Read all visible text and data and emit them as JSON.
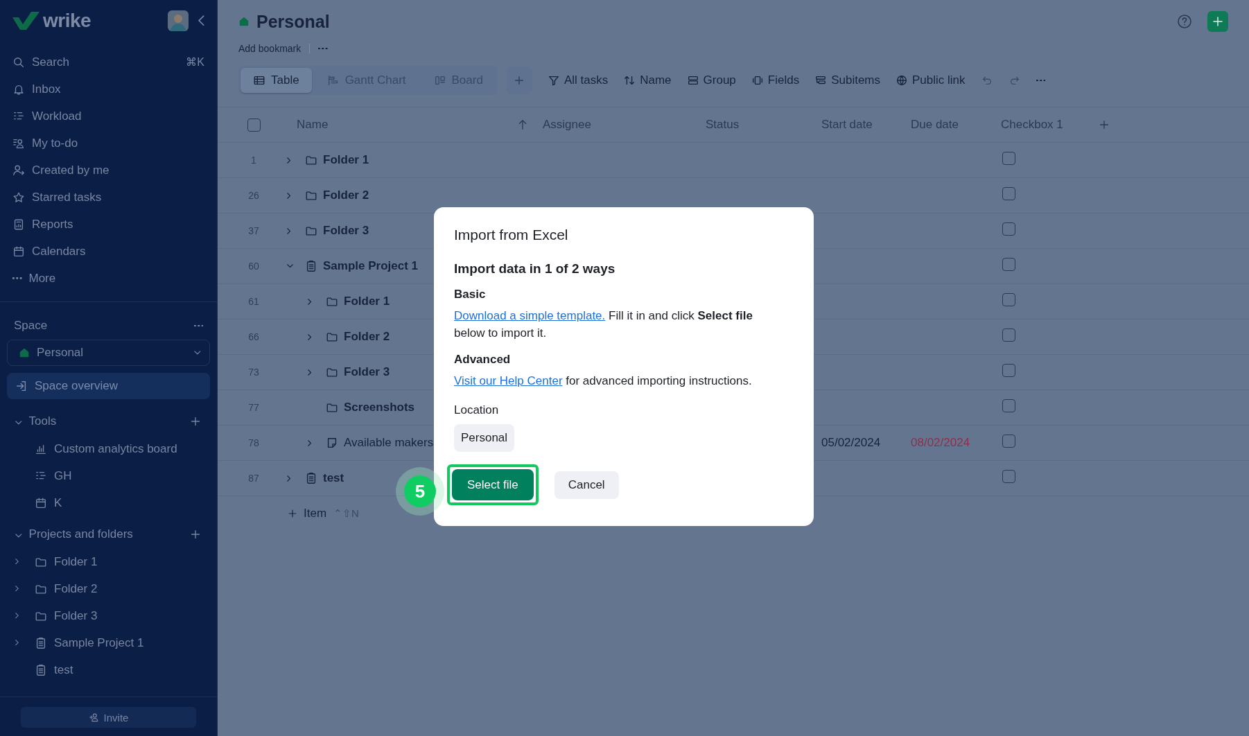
{
  "sidebar": {
    "logo": "wrike",
    "nav": [
      {
        "kind": "search",
        "label": "Search",
        "shortcut": "⌘K"
      },
      {
        "kind": "bell",
        "label": "Inbox"
      },
      {
        "kind": "workload",
        "label": "Workload"
      },
      {
        "kind": "todo",
        "label": "My to-do"
      },
      {
        "kind": "user",
        "label": "Created by me"
      },
      {
        "kind": "star",
        "label": "Starred tasks"
      },
      {
        "kind": "report",
        "label": "Reports"
      },
      {
        "kind": "calendar",
        "label": "Calendars"
      },
      {
        "kind": "dots",
        "label": "More"
      }
    ],
    "space_label": "Space",
    "space_selector": "Personal",
    "space_overview": {
      "label": "Space overview",
      "selected": true
    },
    "tools": {
      "label": "Tools",
      "expanded": true,
      "items": [
        {
          "kind": "analytics",
          "label": "Custom analytics board"
        },
        {
          "kind": "workload",
          "label": "GH"
        },
        {
          "kind": "calendar",
          "label": "K"
        }
      ]
    },
    "projects": {
      "label": "Projects and folders",
      "expanded": true,
      "items": [
        {
          "kind": "folder",
          "label": "Folder 1",
          "expandable": true
        },
        {
          "kind": "folder",
          "label": "Folder 2",
          "expandable": true
        },
        {
          "kind": "folder",
          "label": "Folder 3",
          "expandable": true
        },
        {
          "kind": "project",
          "label": "Sample Project 1",
          "expandable": true
        },
        {
          "kind": "project",
          "label": "test",
          "expandable": false
        }
      ]
    },
    "invite": "Invite"
  },
  "header": {
    "title": "Personal",
    "add_bookmark": "Add bookmark"
  },
  "views": [
    {
      "kind": "table",
      "label": "Table",
      "selected": true
    },
    {
      "kind": "gantt",
      "label": "Gantt Chart",
      "selected": false
    },
    {
      "kind": "board",
      "label": "Board",
      "selected": false
    }
  ],
  "toolbar": [
    {
      "kind": "filter",
      "label": "All tasks"
    },
    {
      "kind": "sort",
      "label": "Name"
    },
    {
      "kind": "group",
      "label": "Group"
    },
    {
      "kind": "fields",
      "label": "Fields"
    },
    {
      "kind": "subitems",
      "label": "Subitems"
    },
    {
      "kind": "globe",
      "label": "Public link"
    }
  ],
  "table": {
    "select_all": {
      "checked": false
    },
    "columns": [
      "Name",
      "Assignee",
      "Status",
      "Start date",
      "Due date",
      "Checkbox 1"
    ],
    "rows": [
      {
        "number": "1",
        "kind": "folder",
        "name": "Folder 1",
        "expandable": true,
        "expanded": false,
        "checked": false
      },
      {
        "number": "26",
        "kind": "folder",
        "name": "Folder 2",
        "expandable": true,
        "expanded": false,
        "checked": false
      },
      {
        "number": "37",
        "kind": "folder",
        "name": "Folder 3",
        "expandable": true,
        "expanded": false,
        "checked": false
      },
      {
        "number": "60",
        "kind": "project",
        "name": "Sample Project 1",
        "expandable": true,
        "expanded": true,
        "checked": false,
        "children": [
          {
            "number": "61",
            "kind": "folder",
            "name": "Folder 1",
            "expandable": true,
            "expanded": false,
            "checked": false
          },
          {
            "number": "66",
            "kind": "folder",
            "name": "Folder 2",
            "expandable": true,
            "expanded": false,
            "checked": false
          },
          {
            "number": "73",
            "kind": "folder",
            "name": "Folder 3",
            "expandable": true,
            "expanded": false,
            "checked": false
          },
          {
            "number": "77",
            "kind": "folder",
            "name": "Screenshots",
            "expandable": false,
            "checked": false
          },
          {
            "number": "78",
            "kind": "task",
            "name": "Available makers",
            "expandable": true,
            "expanded": false,
            "start_date": "05/02/2024",
            "due_date": "08/02/2024",
            "overdue": true,
            "checked": false
          }
        ]
      },
      {
        "number": "87",
        "kind": "project",
        "name": "test",
        "expandable": true,
        "expanded": false,
        "checked": false
      }
    ],
    "add_item": {
      "label": "Item",
      "shortcut": "⌃⇧N"
    }
  },
  "dialog": {
    "title": "Import from Excel",
    "subtitle": "Import data in 1 of 2 ways",
    "sections": [
      {
        "heading": "Basic",
        "link": "Download a simple template.",
        "text": " Fill it in and click **Select file** below to import it."
      },
      {
        "heading": "Advanced",
        "link": "Visit our Help Center",
        "text": " for advanced importing instructions."
      }
    ],
    "location_label": "Location",
    "location": "Personal",
    "buttons": [
      {
        "kind": "primary",
        "label": "Select file",
        "highlighted": true
      },
      {
        "kind": "secondary",
        "label": "Cancel",
        "highlighted": false
      }
    ]
  },
  "step_badge": "5"
}
